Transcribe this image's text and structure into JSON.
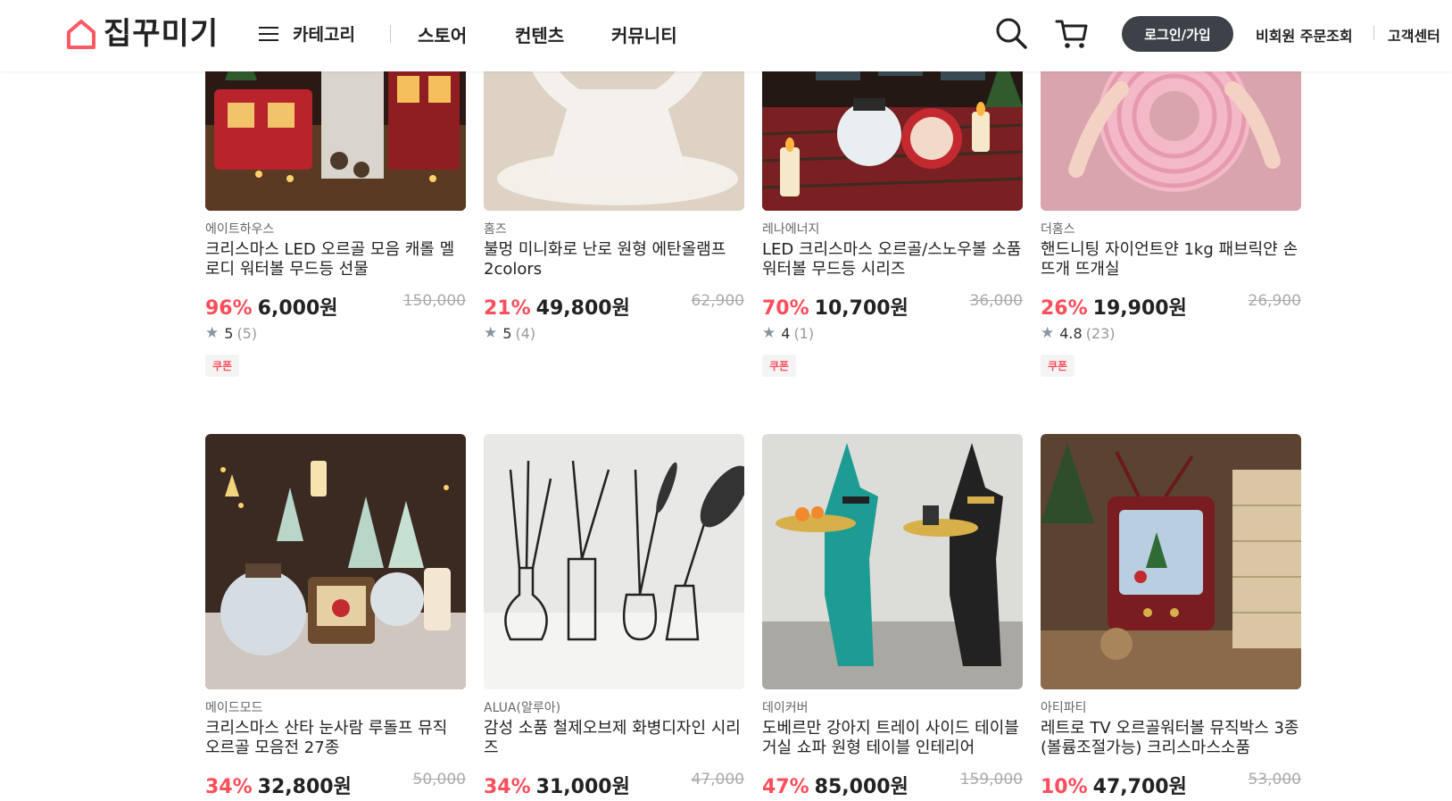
{
  "header": {
    "logo_text": "집꾸미기",
    "menu_label": "카테고리",
    "nav": [
      "스토어",
      "컨텐츠",
      "커뮤니티"
    ],
    "login_label": "로그인/가입",
    "guest_order": "비회원 주문조회",
    "customer_center": "고객센터"
  },
  "colors": {
    "accent": "#ff4e5b",
    "login_bg": "#3d4248"
  },
  "products": [
    {
      "brand": "에이트하우스",
      "title": "크리스마스 LED 오르골 모음 캐롤 멜로디 워터볼 무드등 선물",
      "discount": "96%",
      "price": "6,000원",
      "original": "150,000",
      "score": "5",
      "count": "(5)",
      "coupon": "쿠폰"
    },
    {
      "brand": "홈즈",
      "title": "불멍 미니화로 난로 원형 에탄올램프 2colors",
      "discount": "21%",
      "price": "49,800원",
      "original": "62,900",
      "score": "5",
      "count": "(4)",
      "coupon": ""
    },
    {
      "brand": "레나에너지",
      "title": "LED 크리스마스 오르골/스노우볼 소품 워터볼 무드등 시리즈",
      "discount": "70%",
      "price": "10,700원",
      "original": "36,000",
      "score": "4",
      "count": "(1)",
      "coupon": "쿠폰"
    },
    {
      "brand": "더홈스",
      "title": "핸드니팅 자이언트얀 1kg 패브릭얀 손뜨개 뜨개실",
      "discount": "26%",
      "price": "19,900원",
      "original": "26,900",
      "score": "4.8",
      "count": "(23)",
      "coupon": "쿠폰"
    },
    {
      "brand": "메이드모드",
      "title": "크리스마스 산타 눈사람 루돌프 뮤직 오르골 모음전 27종",
      "discount": "34%",
      "price": "32,800원",
      "original": "50,000"
    },
    {
      "brand": "ALUA(알루아)",
      "title": "감성 소품 철제오브제 화병디자인 시리즈",
      "discount": "34%",
      "price": "31,000원",
      "original": "47,000"
    },
    {
      "brand": "데이커버",
      "title": "도베르만 강아지 트레이 사이드 테이블 거실 쇼파 원형 테이블 인테리어",
      "discount": "47%",
      "price": "85,000원",
      "original": "159,000"
    },
    {
      "brand": "아티파티",
      "title": "레트로 TV 오르골워터볼 뮤직박스 3종 (볼륨조절가능) 크리스마스소품",
      "discount": "10%",
      "price": "47,700원",
      "original": "53,000"
    }
  ]
}
